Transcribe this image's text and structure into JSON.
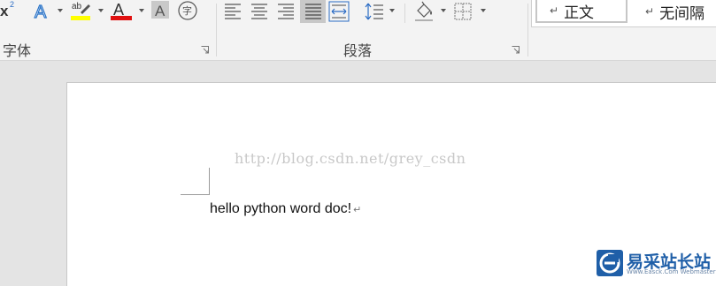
{
  "ribbon": {
    "font_group": {
      "label": "字体",
      "superscript_icon": "superscript-icon",
      "text_effects_icon": "text-effects-icon",
      "highlight_color": "#ffff00",
      "font_color": "#e01010",
      "highlight_icon": "text-highlight-color-icon",
      "font_color_icon": "font-color-icon",
      "char_shading_icon": "character-shading-icon",
      "enclose_char_icon": "enclose-characters-icon",
      "enclose_char_glyph": "字"
    },
    "paragraph_group": {
      "label": "段落",
      "active_alignment": "justify",
      "icons": [
        "align-left-icon",
        "align-center-icon",
        "align-right-icon",
        "justify-icon",
        "distributed-icon",
        "line-spacing-icon",
        "shading-icon",
        "borders-icon"
      ]
    },
    "styles": {
      "items": [
        {
          "label": "正文",
          "selected": true
        },
        {
          "label": "无间隔",
          "selected": false
        }
      ]
    }
  },
  "document": {
    "watermark": "http://blog.csdn.net/grey_csdn",
    "body_text": "hello python word doc!",
    "paragraph_mark": "↵"
  },
  "logo": {
    "text": "易采站长站",
    "subtext": "Www.Easck.Com Webmaster",
    "color": "#1f5fa8"
  }
}
